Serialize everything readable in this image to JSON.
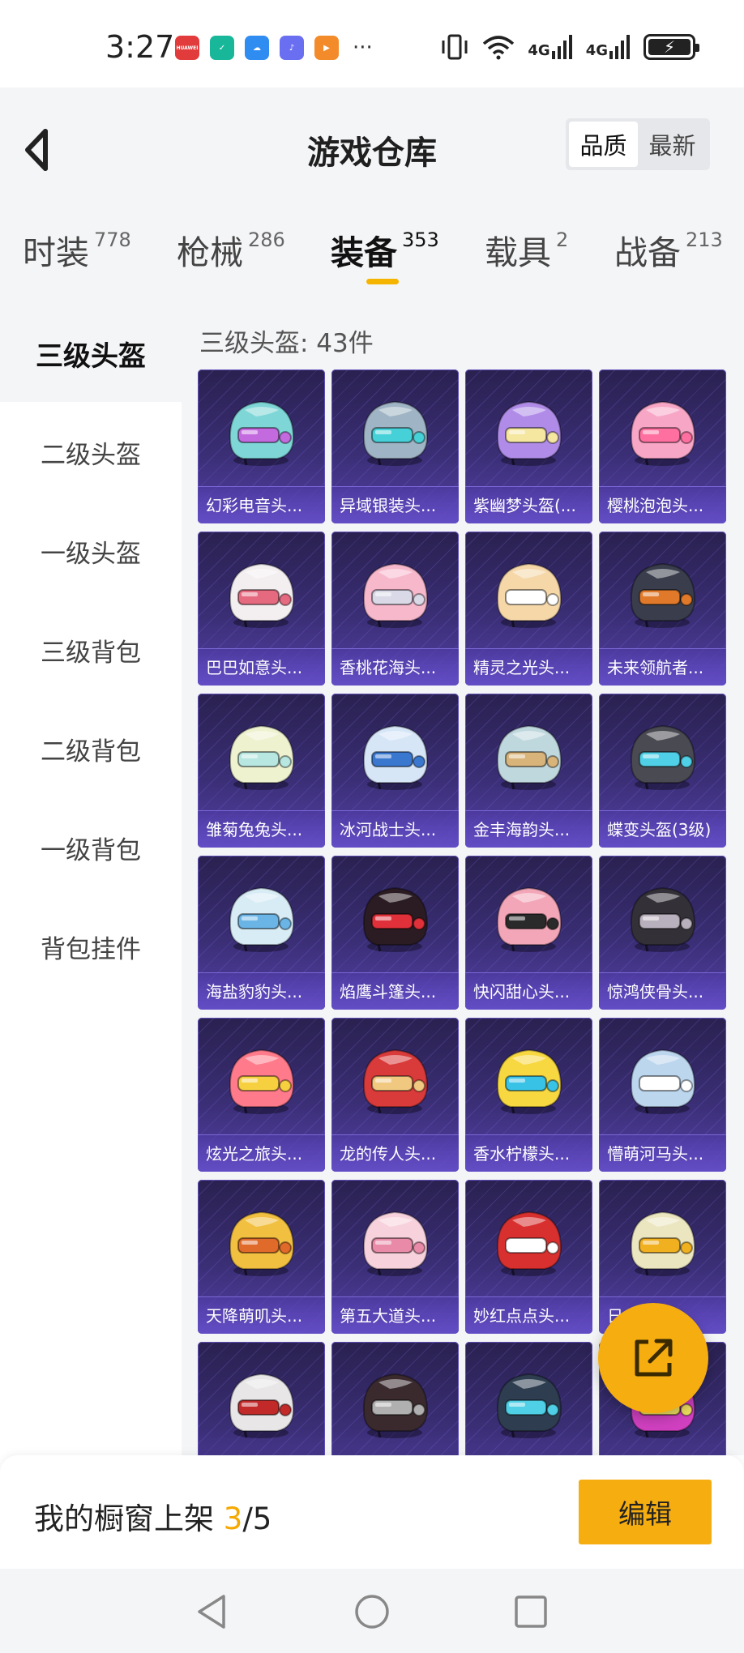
{
  "status_bar": {
    "time": "3:27",
    "apps": [
      {
        "icon": "huawei-app-icon",
        "color": "#e23b3b",
        "text": "HUAWEI"
      },
      {
        "icon": "shield-app-icon",
        "color": "#19b79a",
        "text": "✓"
      },
      {
        "icon": "cloud-app-icon",
        "color": "#2f8cf0",
        "text": "☁"
      },
      {
        "icon": "music-app-icon",
        "color": "#6a6ef0",
        "text": "♪"
      },
      {
        "icon": "video-app-icon",
        "color": "#f38b2b",
        "text": "▶"
      }
    ],
    "more": "···",
    "network_1": "4G",
    "network_2": "4G"
  },
  "header": {
    "title": "游戏仓库",
    "sort_quality": "品质",
    "sort_latest": "最新"
  },
  "tabs": [
    {
      "label": "时装",
      "count": "778"
    },
    {
      "label": "枪械",
      "count": "286"
    },
    {
      "label": "装备",
      "count": "353"
    },
    {
      "label": "载具",
      "count": "2"
    },
    {
      "label": "战备",
      "count": "213"
    }
  ],
  "sidebar": [
    {
      "label": "三级头盔"
    },
    {
      "label": "二级头盔"
    },
    {
      "label": "一级头盔"
    },
    {
      "label": "三级背包"
    },
    {
      "label": "二级背包"
    },
    {
      "label": "一级背包"
    },
    {
      "label": "背包挂件"
    }
  ],
  "content": {
    "heading": "三级头盔: 43件"
  },
  "items": [
    {
      "name": "幻彩电音头...",
      "main": "#7fd6d6",
      "accent": "#c46adf"
    },
    {
      "name": "异域银装头...",
      "main": "#9fb4c4",
      "accent": "#46d0d8"
    },
    {
      "name": "紫幽梦头盔(...",
      "main": "#b08ce8",
      "accent": "#f5e6a0"
    },
    {
      "name": "樱桃泡泡头...",
      "main": "#f7a6c6",
      "accent": "#ff6fa0"
    },
    {
      "name": "巴巴如意头...",
      "main": "#f3eef0",
      "accent": "#e56a80"
    },
    {
      "name": "香桃花海头...",
      "main": "#f7b8cc",
      "accent": "#d9d9e8"
    },
    {
      "name": "精灵之光头...",
      "main": "#f5d7a8",
      "accent": "#ffffff"
    },
    {
      "name": "未来领航者...",
      "main": "#3a3e4c",
      "accent": "#e07a2a"
    },
    {
      "name": "雏菊兔兔头...",
      "main": "#eef2cf",
      "accent": "#b7e7e0"
    },
    {
      "name": "冰河战士头...",
      "main": "#d6e6f7",
      "accent": "#3a78d0"
    },
    {
      "name": "金丰海韵头...",
      "main": "#bfd8de",
      "accent": "#d8b47a"
    },
    {
      "name": "蝶变头盔(3级)",
      "main": "#4a4a52",
      "accent": "#4fd0e6"
    },
    {
      "name": "海盐豹豹头...",
      "main": "#d8ecf6",
      "accent": "#6bb5e6"
    },
    {
      "name": "焰鹰斗篷头...",
      "main": "#2a1c22",
      "accent": "#e0303a"
    },
    {
      "name": "快闪甜心头...",
      "main": "#f2a6b8",
      "accent": "#2a2a2a"
    },
    {
      "name": "惊鸿侠骨头...",
      "main": "#343038",
      "accent": "#b8b0bc"
    },
    {
      "name": "炫光之旅头...",
      "main": "#ff7a8a",
      "accent": "#f7d040"
    },
    {
      "name": "龙的传人头...",
      "main": "#d93a3a",
      "accent": "#f0c880"
    },
    {
      "name": "香水柠檬头...",
      "main": "#f7d840",
      "accent": "#38c2e6"
    },
    {
      "name": "懵萌河马头...",
      "main": "#bcd6ee",
      "accent": "#ffffff"
    },
    {
      "name": "天降萌叽头...",
      "main": "#f2c040",
      "accent": "#e06a2a"
    },
    {
      "name": "第五大道头...",
      "main": "#f7d2dc",
      "accent": "#e88aa8"
    },
    {
      "name": "妙红点点头...",
      "main": "#d8302e",
      "accent": "#ffffff"
    },
    {
      "name": "日...",
      "main": "#ebe6c0",
      "accent": "#f0b020"
    },
    {
      "name": "",
      "main": "#e8e6e6",
      "accent": "#c22a2a"
    },
    {
      "name": "",
      "main": "#3a2a2e",
      "accent": "#b0b0b0"
    },
    {
      "name": "",
      "main": "#2e3e50",
      "accent": "#4fd0e6"
    },
    {
      "name": "",
      "main": "#d040c0",
      "accent": "#f0e060"
    }
  ],
  "bottom": {
    "shelf_label": "我的橱窗上架",
    "shelf_current": "3",
    "shelf_total": "/5",
    "edit_label": "编辑"
  },
  "colors": {
    "accent": "#f6ad0f",
    "card_top": "#2a2150",
    "card_bottom": "#5641a8"
  }
}
